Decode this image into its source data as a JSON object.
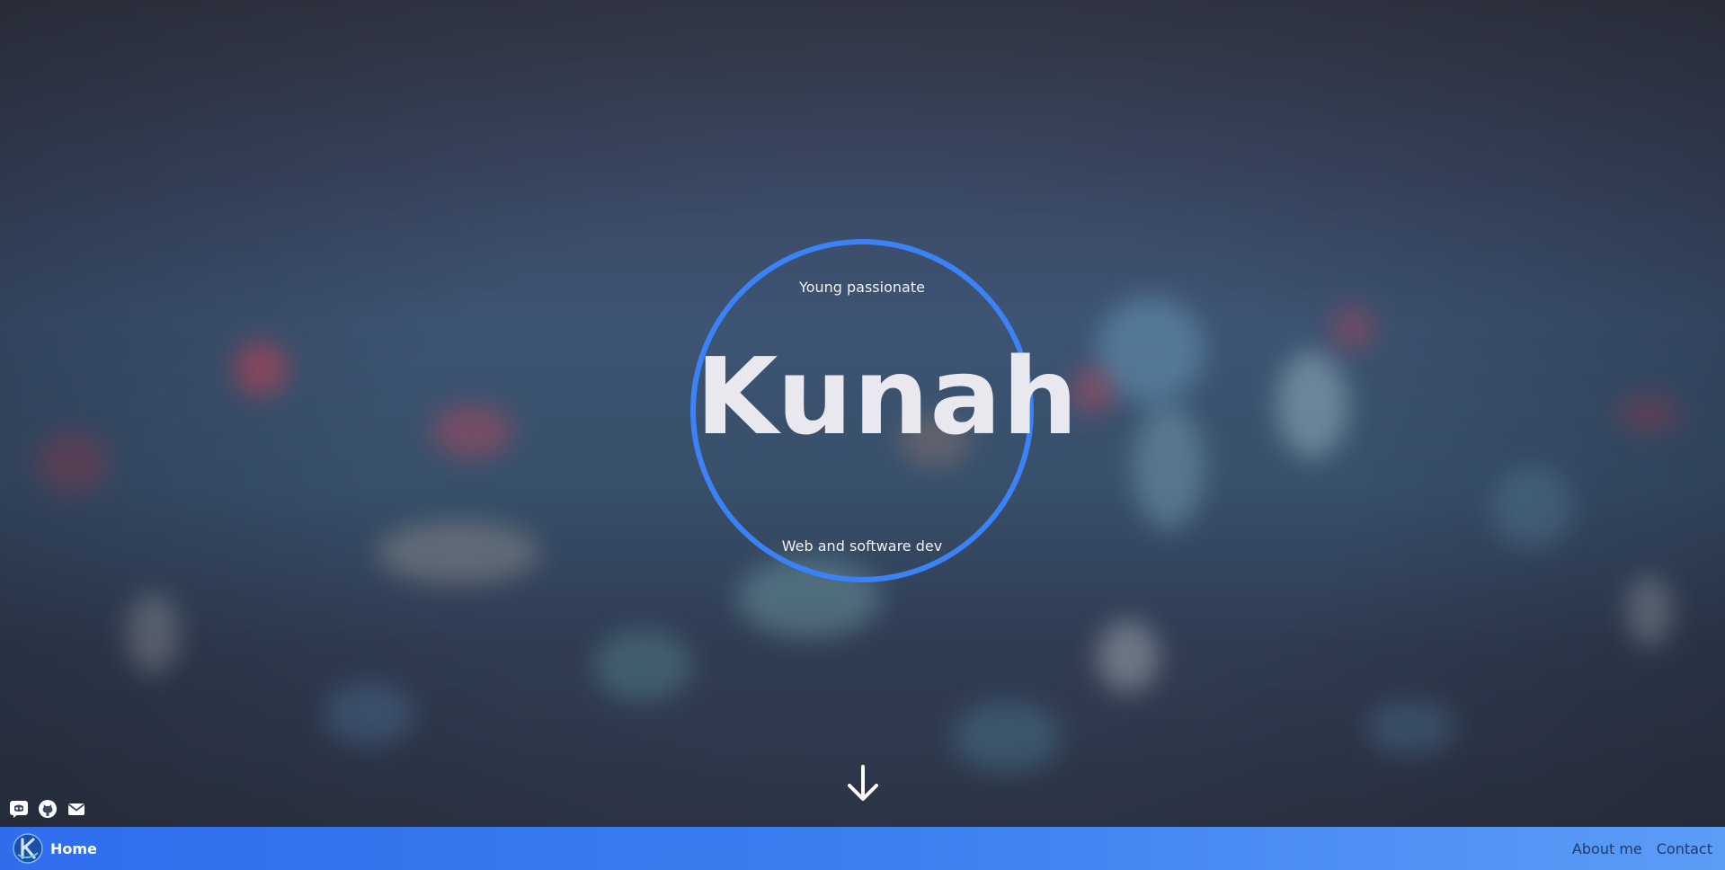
{
  "hero": {
    "tagline_top": "Young passionate",
    "title": "Kunah",
    "tagline_bottom": "Web and software dev",
    "ring_color": "#3b82f6"
  },
  "scroll": {
    "icon": "arrow-down-icon"
  },
  "socials": [
    {
      "icon": "discord-icon"
    },
    {
      "icon": "github-icon"
    },
    {
      "icon": "mail-icon"
    }
  ],
  "navbar": {
    "logo_icon": "kunah-logo",
    "home_label": "Home",
    "links": [
      {
        "label": "About me"
      },
      {
        "label": "Contact"
      }
    ],
    "gradient_start": "#2f6ded",
    "gradient_end": "#5b9cf6"
  }
}
